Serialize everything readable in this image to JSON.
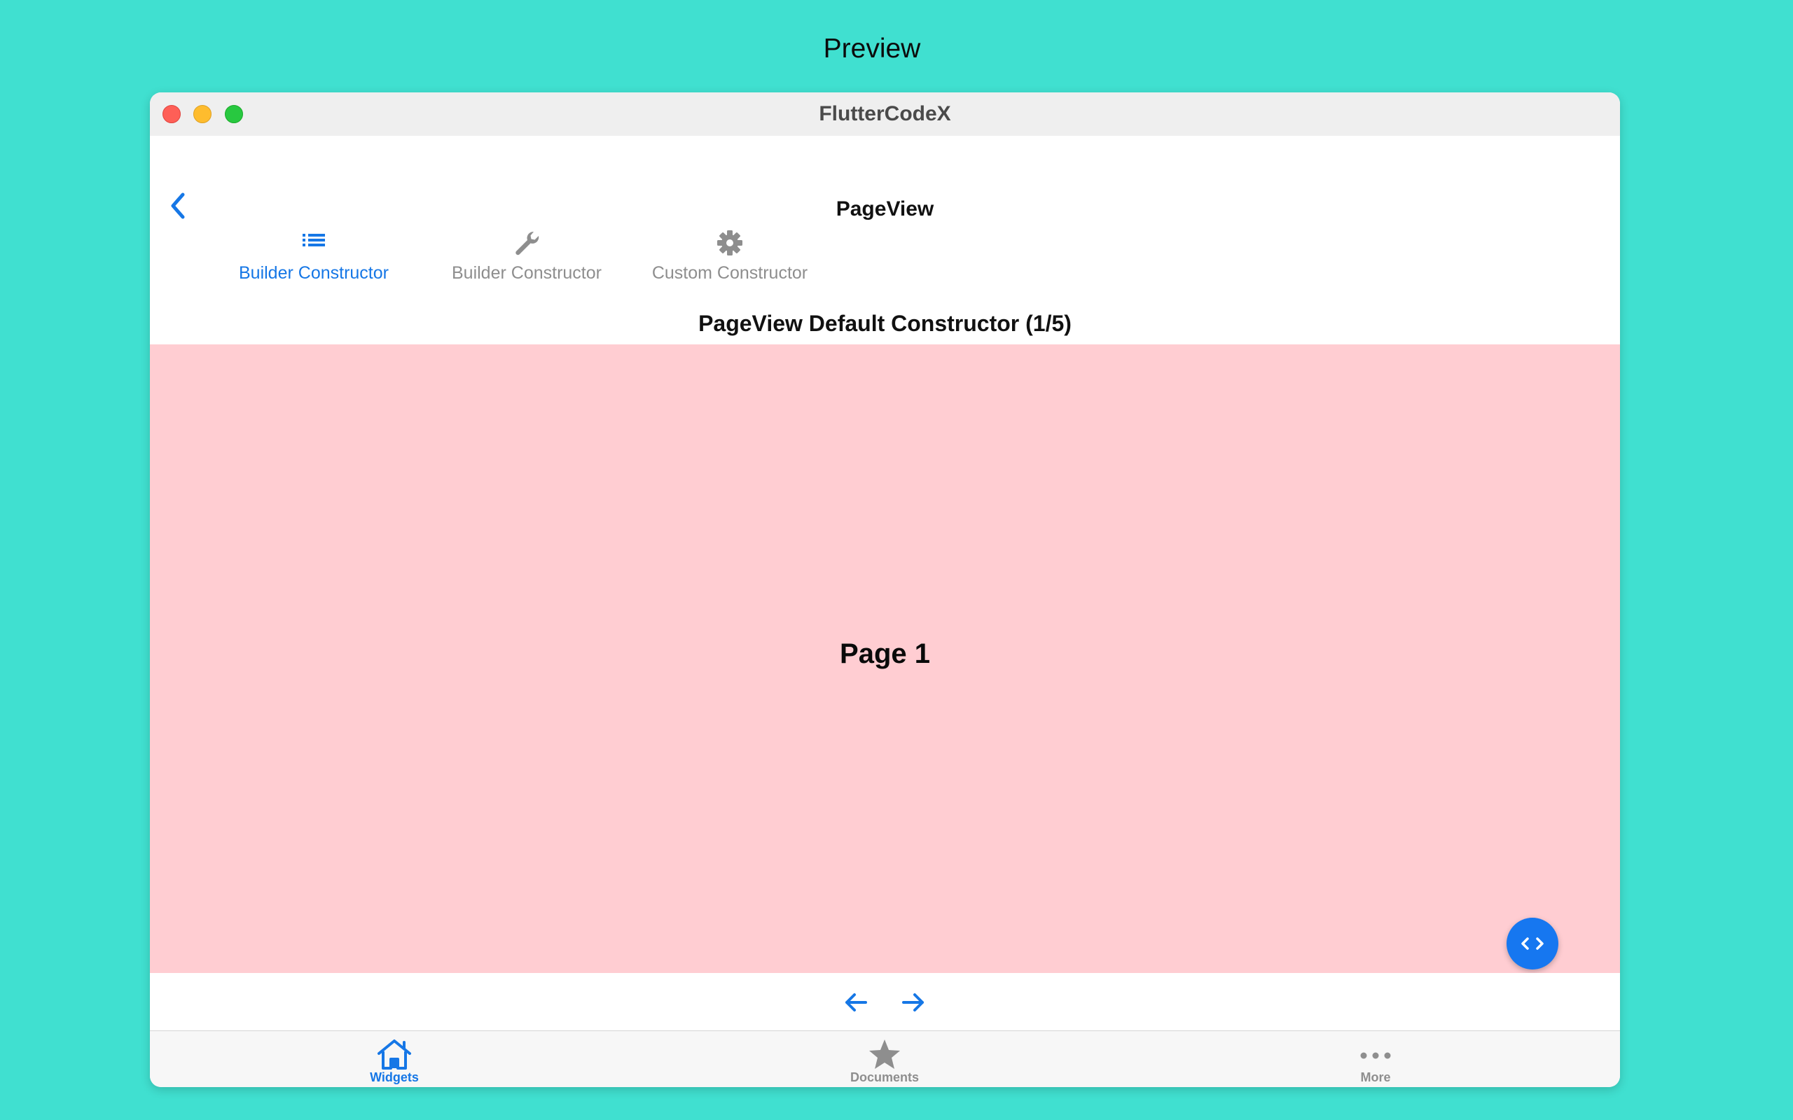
{
  "preview": {
    "title": "Preview"
  },
  "window": {
    "title": "FlutterCodeX"
  },
  "appbar": {
    "title": "PageView"
  },
  "tabs": [
    {
      "label": "Builder Constructor",
      "icon": "list-icon",
      "selected": true
    },
    {
      "label": "Builder Constructor",
      "icon": "wrench-icon",
      "selected": false
    },
    {
      "label": "Custom Constructor",
      "icon": "gear-icon",
      "selected": false
    }
  ],
  "content": {
    "header": "PageView Default Constructor (1/5)",
    "page_label": "Page 1",
    "current_page": 1,
    "total_pages": 5
  },
  "bottom_nav": [
    {
      "label": "Widgets",
      "icon": "home-icon",
      "selected": true
    },
    {
      "label": "Documents",
      "icon": "star-icon",
      "selected": false
    },
    {
      "label": "More",
      "icon": "more-dots-icon",
      "selected": false
    }
  ],
  "colors": {
    "background": "#40E0D0",
    "accent": "#1677E6",
    "inactive": "#8E8E8E",
    "page": "#FFCDD2"
  }
}
